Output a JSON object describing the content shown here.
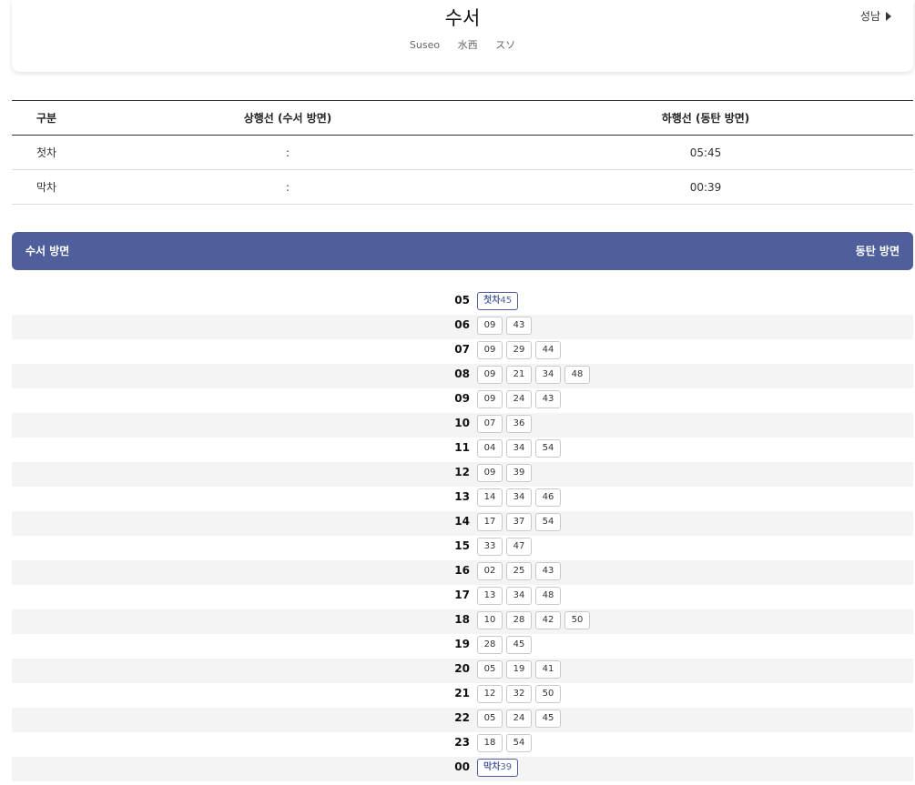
{
  "station": {
    "name": "수서",
    "romanized": "Suseo",
    "hanja": "水西",
    "katakana": "スソ",
    "next": "성남"
  },
  "first_last": {
    "headers": [
      "구분",
      "상행선 (수서 방면)",
      "하행선 (동탄 방면)"
    ],
    "rows": [
      {
        "label": "첫차",
        "up": ":",
        "down": "05:45"
      },
      {
        "label": "막차",
        "up": ":",
        "down": "00:39"
      }
    ]
  },
  "direction": {
    "left": "수서 방면",
    "right": "동탄 방면"
  },
  "timetable": {
    "first_tag": "첫차",
    "last_tag": "막차",
    "rows": [
      {
        "hour": "05",
        "mins": [
          "45"
        ],
        "tag": "first"
      },
      {
        "hour": "06",
        "mins": [
          "09",
          "43"
        ]
      },
      {
        "hour": "07",
        "mins": [
          "09",
          "29",
          "44"
        ]
      },
      {
        "hour": "08",
        "mins": [
          "09",
          "21",
          "34",
          "48"
        ]
      },
      {
        "hour": "09",
        "mins": [
          "09",
          "24",
          "43"
        ]
      },
      {
        "hour": "10",
        "mins": [
          "07",
          "36"
        ]
      },
      {
        "hour": "11",
        "mins": [
          "04",
          "34",
          "54"
        ]
      },
      {
        "hour": "12",
        "mins": [
          "09",
          "39"
        ]
      },
      {
        "hour": "13",
        "mins": [
          "14",
          "34",
          "46"
        ]
      },
      {
        "hour": "14",
        "mins": [
          "17",
          "37",
          "54"
        ]
      },
      {
        "hour": "15",
        "mins": [
          "33",
          "47"
        ]
      },
      {
        "hour": "16",
        "mins": [
          "02",
          "25",
          "43"
        ]
      },
      {
        "hour": "17",
        "mins": [
          "13",
          "34",
          "48"
        ]
      },
      {
        "hour": "18",
        "mins": [
          "10",
          "28",
          "42",
          "50"
        ]
      },
      {
        "hour": "19",
        "mins": [
          "28",
          "45"
        ]
      },
      {
        "hour": "20",
        "mins": [
          "05",
          "19",
          "41"
        ]
      },
      {
        "hour": "21",
        "mins": [
          "12",
          "32",
          "50"
        ]
      },
      {
        "hour": "22",
        "mins": [
          "05",
          "24",
          "45"
        ]
      },
      {
        "hour": "23",
        "mins": [
          "18",
          "54"
        ]
      },
      {
        "hour": "00",
        "mins": [
          "39"
        ],
        "tag": "last"
      }
    ]
  },
  "colors": {
    "accent": "#4f5f9b",
    "row_alt": "#f4f4f4"
  }
}
